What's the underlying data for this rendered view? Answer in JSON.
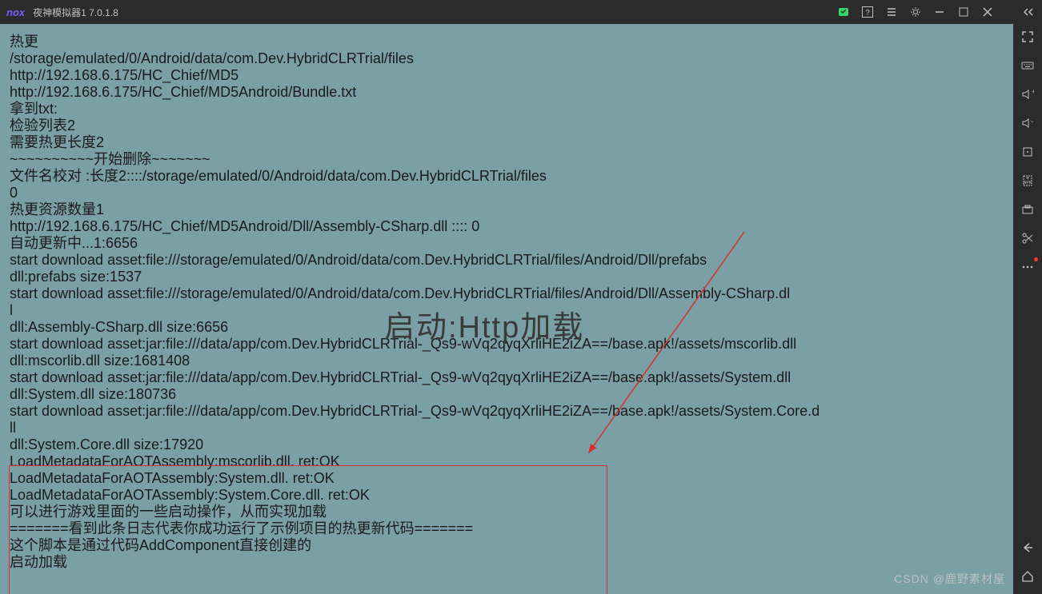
{
  "titlebar": {
    "logo": "nox",
    "title": "夜神模拟器1 7.0.1.8"
  },
  "overlay": "启动:Http加载",
  "watermark": "CSDN @鹿野素材屋",
  "log": [
    "热更",
    "/storage/emulated/0/Android/data/com.Dev.HybridCLRTrial/files",
    "http://192.168.6.175/HC_Chief/MD5",
    "http://192.168.6.175/HC_Chief/MD5Android/Bundle.txt",
    "拿到txt:",
    "检验列表2",
    "需要热更长度2",
    "~~~~~~~~~~开始删除~~~~~~~",
    "文件名校对 :长度2::::/storage/emulated/0/Android/data/com.Dev.HybridCLRTrial/files",
    "0",
    "热更资源数量1",
    "http://192.168.6.175/HC_Chief/MD5Android/Dll/Assembly-CSharp.dll  ::::   0",
    "自动更新中...1:6656",
    "start download asset:file:///storage/emulated/0/Android/data/com.Dev.HybridCLRTrial/files/Android/Dll/prefabs",
    "dll:prefabs  size:1537",
    "start download asset:file:///storage/emulated/0/Android/data/com.Dev.HybridCLRTrial/files/Android/Dll/Assembly-CSharp.dl",
    "l",
    "dll:Assembly-CSharp.dll  size:6656",
    "start download asset:jar:file:///data/app/com.Dev.HybridCLRTrial-_Qs9-wVq2qyqXrliHE2iZA==/base.apk!/assets/mscorlib.dll",
    "dll:mscorlib.dll  size:1681408",
    "start download asset:jar:file:///data/app/com.Dev.HybridCLRTrial-_Qs9-wVq2qyqXrliHE2iZA==/base.apk!/assets/System.dll",
    "dll:System.dll  size:180736",
    "start download asset:jar:file:///data/app/com.Dev.HybridCLRTrial-_Qs9-wVq2qyqXrliHE2iZA==/base.apk!/assets/System.Core.d",
    "ll",
    "dll:System.Core.dll  size:17920",
    "LoadMetadataForAOTAssembly:mscorlib.dll. ret:OK",
    "LoadMetadataForAOTAssembly:System.dll. ret:OK",
    "LoadMetadataForAOTAssembly:System.Core.dll. ret:OK",
    "可以进行游戏里面的一些启动操作，从而实现加载",
    "=======看到此条日志代表你成功运行了示例项目的热更新代码=======",
    "这个脚本是通过代码AddComponent直接创建的",
    "启动加载"
  ]
}
